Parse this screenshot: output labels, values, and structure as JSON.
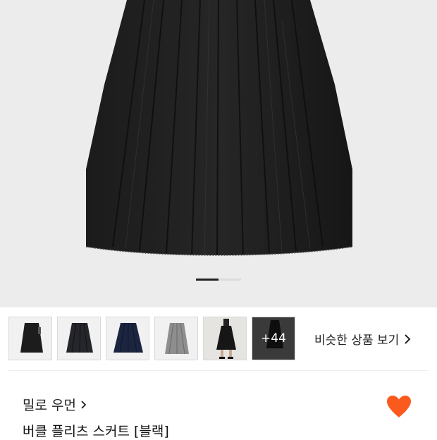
{
  "gallery": {
    "image_alt": "black pleated skirt",
    "pager": {
      "total": 2,
      "active": 0
    }
  },
  "thumbnails": [
    {
      "name": "black-skirt"
    },
    {
      "name": "charcoal-skirt"
    },
    {
      "name": "navy-skirt"
    },
    {
      "name": "gray-skirt"
    },
    {
      "name": "model-photo"
    },
    {
      "name": "more",
      "label": "+44"
    }
  ],
  "similar": {
    "label": "비슷한 상품 보기"
  },
  "product": {
    "brand": "밀로 우먼",
    "title": "버클 플리츠 스커트 [블랙]",
    "liked": true
  },
  "colors": {
    "heart": "#fa5a1e",
    "background": "#ececec"
  }
}
